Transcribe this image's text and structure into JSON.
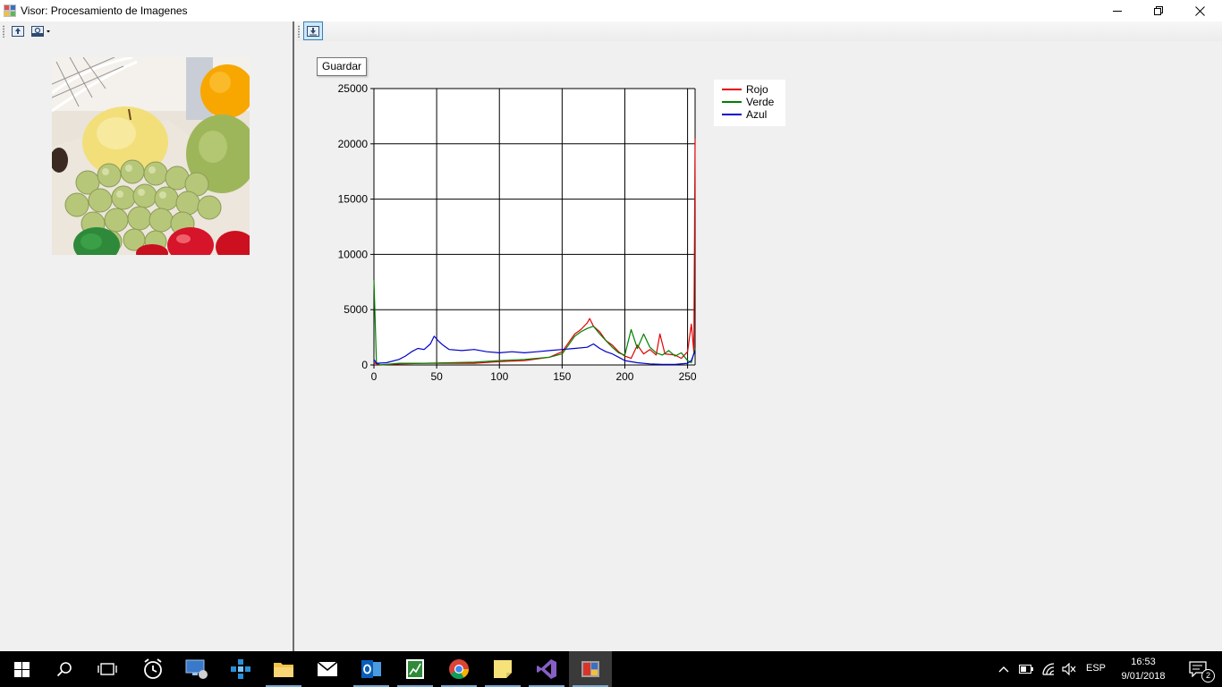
{
  "window": {
    "title": "Visor: Procesamiento de Imagenes",
    "controls": [
      "minimize-icon",
      "restore-icon",
      "close-icon"
    ]
  },
  "left_toolbar": {
    "buttons": [
      "open-image-icon",
      "filter-dropdown-icon"
    ]
  },
  "picture": {
    "description_icon": "fruit-photo"
  },
  "right_toolbar": {
    "buttons": [
      "save-icon"
    ],
    "tooltip": "Guardar"
  },
  "colors": {
    "rojo": "#e00000",
    "verde": "#008000",
    "azul": "#0000cc",
    "accent": "#3c7fb1"
  },
  "chart_data": {
    "type": "line",
    "title": "",
    "xlabel": "",
    "ylabel": "",
    "xlim": [
      0,
      256
    ],
    "ylim": [
      0,
      25000
    ],
    "x_ticks": [
      "0",
      "50",
      "100",
      "150",
      "200",
      "250"
    ],
    "y_ticks": [
      "0",
      "5000",
      "10000",
      "15000",
      "20000",
      "25000"
    ],
    "grid": true,
    "legend_position": "top-right",
    "series": [
      {
        "name": "Rojo",
        "color": "#e00000",
        "points": [
          [
            0,
            200
          ],
          [
            5,
            0
          ],
          [
            20,
            100
          ],
          [
            40,
            150
          ],
          [
            60,
            150
          ],
          [
            80,
            150
          ],
          [
            100,
            300
          ],
          [
            120,
            400
          ],
          [
            140,
            700
          ],
          [
            150,
            1200
          ],
          [
            155,
            2000
          ],
          [
            160,
            2800
          ],
          [
            165,
            3200
          ],
          [
            170,
            3800
          ],
          [
            172,
            4200
          ],
          [
            175,
            3500
          ],
          [
            180,
            3000
          ],
          [
            185,
            2200
          ],
          [
            190,
            1800
          ],
          [
            195,
            1200
          ],
          [
            200,
            800
          ],
          [
            205,
            600
          ],
          [
            210,
            1800
          ],
          [
            215,
            1000
          ],
          [
            220,
            1400
          ],
          [
            225,
            900
          ],
          [
            228,
            2800
          ],
          [
            232,
            1000
          ],
          [
            240,
            900
          ],
          [
            245,
            600
          ],
          [
            250,
            1200
          ],
          [
            253,
            3700
          ],
          [
            255,
            1200
          ],
          [
            256,
            20500
          ]
        ]
      },
      {
        "name": "Verde",
        "color": "#008000",
        "points": [
          [
            0,
            7700
          ],
          [
            2,
            200
          ],
          [
            5,
            0
          ],
          [
            20,
            150
          ],
          [
            40,
            150
          ],
          [
            60,
            200
          ],
          [
            80,
            250
          ],
          [
            100,
            400
          ],
          [
            120,
            500
          ],
          [
            140,
            700
          ],
          [
            150,
            1000
          ],
          [
            155,
            1800
          ],
          [
            160,
            2600
          ],
          [
            165,
            3000
          ],
          [
            170,
            3300
          ],
          [
            175,
            3500
          ],
          [
            180,
            2800
          ],
          [
            185,
            2200
          ],
          [
            190,
            1600
          ],
          [
            195,
            1100
          ],
          [
            200,
            900
          ],
          [
            205,
            3200
          ],
          [
            210,
            1500
          ],
          [
            215,
            2800
          ],
          [
            220,
            1600
          ],
          [
            225,
            1100
          ],
          [
            230,
            900
          ],
          [
            235,
            1300
          ],
          [
            240,
            800
          ],
          [
            245,
            1100
          ],
          [
            250,
            400
          ],
          [
            253,
            200
          ],
          [
            256,
            1500
          ]
        ]
      },
      {
        "name": "Azul",
        "color": "#0000cc",
        "points": [
          [
            0,
            500
          ],
          [
            2,
            150
          ],
          [
            10,
            200
          ],
          [
            20,
            500
          ],
          [
            25,
            800
          ],
          [
            30,
            1200
          ],
          [
            35,
            1500
          ],
          [
            40,
            1400
          ],
          [
            45,
            1900
          ],
          [
            48,
            2600
          ],
          [
            52,
            2100
          ],
          [
            55,
            1800
          ],
          [
            60,
            1400
          ],
          [
            70,
            1300
          ],
          [
            80,
            1400
          ],
          [
            90,
            1200
          ],
          [
            100,
            1100
          ],
          [
            110,
            1200
          ],
          [
            120,
            1100
          ],
          [
            130,
            1200
          ],
          [
            140,
            1300
          ],
          [
            150,
            1400
          ],
          [
            160,
            1500
          ],
          [
            170,
            1600
          ],
          [
            175,
            1900
          ],
          [
            180,
            1500
          ],
          [
            185,
            1200
          ],
          [
            190,
            1000
          ],
          [
            195,
            700
          ],
          [
            200,
            400
          ],
          [
            210,
            200
          ],
          [
            220,
            100
          ],
          [
            230,
            50
          ],
          [
            240,
            50
          ],
          [
            250,
            150
          ],
          [
            253,
            400
          ],
          [
            256,
            1300
          ]
        ]
      }
    ]
  },
  "taskbar": {
    "apps": [
      "windows-start-icon",
      "search-icon",
      "task-view-icon",
      "alarms-icon",
      "remote-desktop-icon",
      "network-app-icon",
      "file-explorer-icon",
      "mail-icon",
      "outlook-icon",
      "spreadsheet-icon",
      "chrome-icon",
      "sticky-notes-icon",
      "visual-studio-icon",
      "app-window-icon"
    ],
    "tray": {
      "language": "ESP",
      "time": "16:53",
      "date": "9/01/2018",
      "notifications": "2"
    }
  }
}
